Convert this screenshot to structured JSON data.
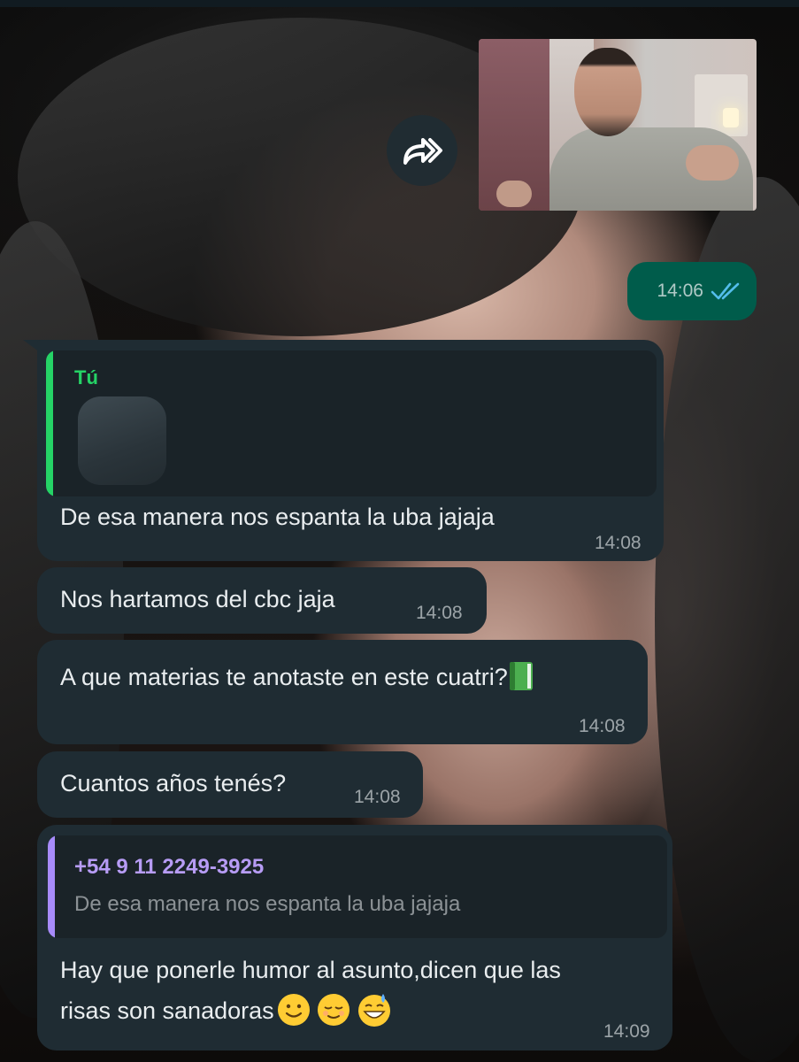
{
  "chat": {
    "forwarded_media": {
      "icon": "forward-icon",
      "time": "14:06",
      "status_icon": "double-check-read-icon"
    },
    "messages": [
      {
        "quote": {
          "sender": "Tú",
          "media": "image-thumbnail"
        },
        "text": "De esa manera nos espanta la uba jajaja",
        "time": "14:08"
      },
      {
        "text": "Nos hartamos del cbc jaja",
        "time": "14:08"
      },
      {
        "text": "A que materias te anotaste en este cuatri?",
        "emoji": "green-book-icon",
        "time": "14:08"
      },
      {
        "text": "Cuantos años tenés?",
        "time": "14:08"
      },
      {
        "quote": {
          "sender": "+54 9 11 2249-3925",
          "text": "De esa manera nos espanta la uba jajaja"
        },
        "text_line1": "Hay que ponerle humor al asunto,dicen que las",
        "text_line2": "risas son sanadoras",
        "emojis": [
          "slightly-smiling-face-icon",
          "relieved-face-icon",
          "grinning-sweat-face-icon"
        ],
        "time": "14:09"
      }
    ]
  },
  "colors": {
    "incoming_bubble": "#1f2c33",
    "outgoing_bubble": "#005c4b",
    "quote_self": "#25d366",
    "quote_other": "#a78bfa",
    "read_ticks": "#53bdeb"
  }
}
